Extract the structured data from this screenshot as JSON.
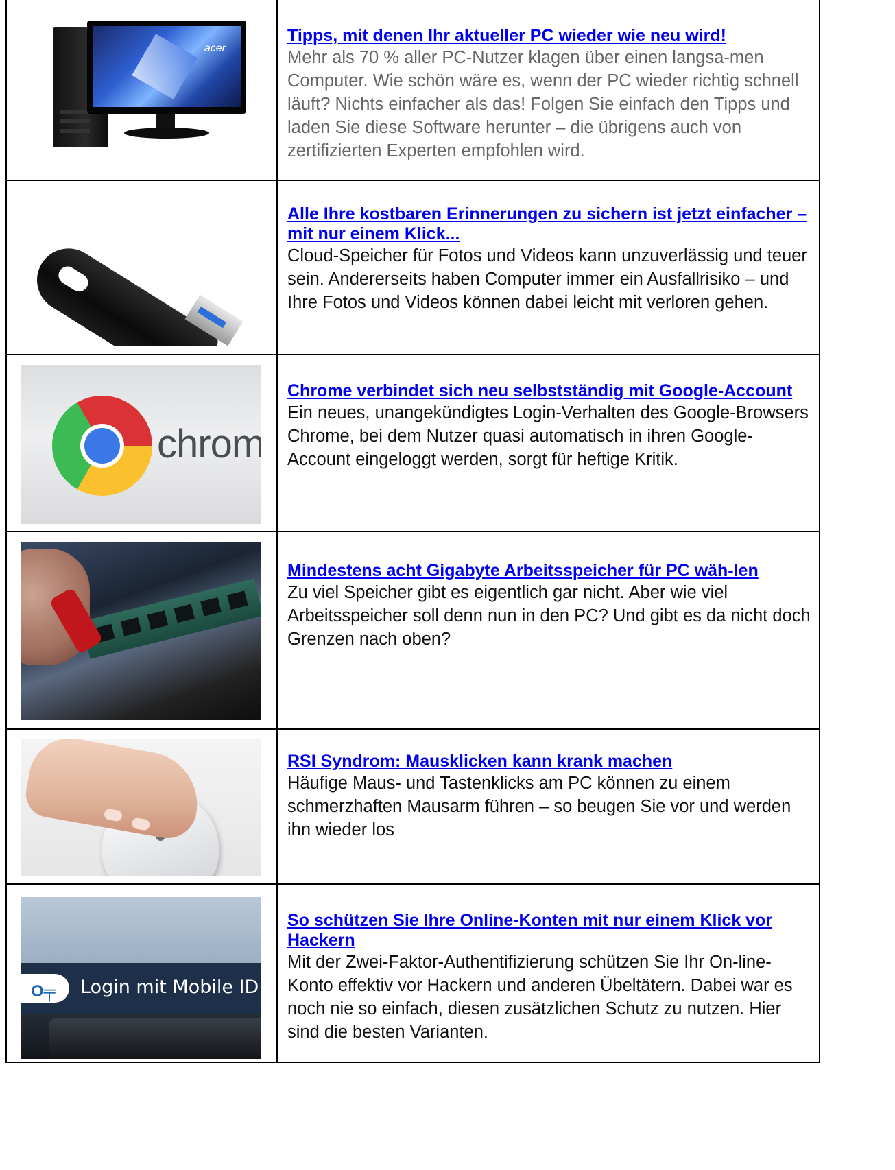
{
  "articles": [
    {
      "title": "Tipps, mit denen Ihr aktueller PC wieder wie neu wird!",
      "text": "Mehr als 70 % aller PC-Nutzer klagen über einen langsa-men Computer. Wie schön wäre es, wenn der PC wieder richtig schnell läuft? Nichts einfacher als das! Folgen Sie einfach den Tipps und laden Sie diese Software herunter – die übrigens auch von zertifizierten Experten empfohlen wird.",
      "image_brand": "acer"
    },
    {
      "title": "Alle Ihre kostbaren Erinnerungen zu sichern ist jetzt einfacher – mit nur einem Klick...",
      "text": "Cloud-Speicher für Fotos und Videos kann unzuverlässig und teuer sein. Andererseits haben Computer immer ein Ausfallrisiko – und Ihre Fotos und Videos können dabei leicht mit verloren gehen."
    },
    {
      "title": "Chrome verbindet sich neu selbstständig mit Google-Account",
      "text": "Ein neues, unangekündigtes Login-Verhalten des Google-Browsers Chrome, bei dem Nutzer quasi automatisch in ihren Google-Account eingeloggt werden, sorgt für heftige Kritik.",
      "image_word": "chrome"
    },
    {
      "title": "Mindestens acht Gigabyte Arbeitsspeicher für PC wäh-len",
      "text": "Zu viel Speicher gibt es eigentlich gar nicht. Aber wie viel Arbeitsspeicher soll denn nun in den PC? Und gibt es da nicht doch Grenzen nach oben?"
    },
    {
      "title": "RSI Syndrom: Mausklicken kann krank machen",
      "text": "Häufige Maus- und Tastenklicks am PC können zu einem schmerzhaften Mausarm führen – so beugen Sie vor und werden ihn wieder los"
    },
    {
      "title": "So schützen Sie Ihre Online-Konten mit nur einem Klick vor Hackern",
      "text": "Mit der Zwei-Faktor-Authentifizierung schützen Sie Ihr On-line-Konto effektiv vor Hackern und anderen Übeltätern. Dabei war es noch nie so einfach, diesen zusätzlichen Schutz zu nutzen. Hier sind die besten Varianten.",
      "image_text": "Login mit Mobile ID"
    }
  ],
  "colors": {
    "link": "#0000ee",
    "border": "#000000",
    "grey_text": "#666666",
    "body_text": "#111111"
  }
}
